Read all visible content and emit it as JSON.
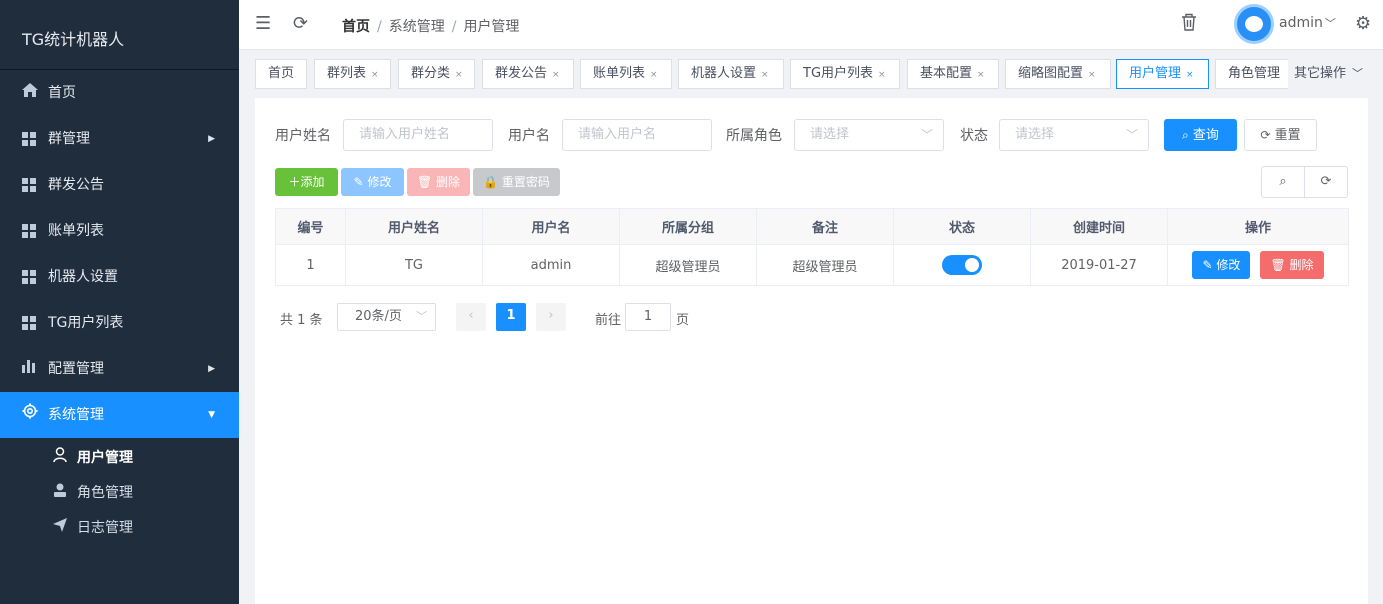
{
  "app": {
    "title": "TG统计机器人"
  },
  "sidebar": {
    "items": [
      {
        "label": "首页",
        "icon": "home-icon"
      },
      {
        "label": "群管理",
        "icon": "grid-icon",
        "expandable": true
      },
      {
        "label": "群发公告",
        "icon": "grid-icon"
      },
      {
        "label": "账单列表",
        "icon": "grid-icon"
      },
      {
        "label": "机器人设置",
        "icon": "grid-icon"
      },
      {
        "label": "TG用户列表",
        "icon": "grid-icon"
      },
      {
        "label": "配置管理",
        "icon": "bar-chart-icon",
        "expandable": true
      },
      {
        "label": "系统管理",
        "icon": "gear-icon",
        "expanded": true
      }
    ],
    "sub_items": [
      {
        "label": "用户管理",
        "icon": "user-icon"
      },
      {
        "label": "角色管理",
        "icon": "role-icon"
      },
      {
        "label": "日志管理",
        "icon": "send-icon"
      }
    ]
  },
  "header": {
    "breadcrumb": [
      "首页",
      "系统管理",
      "用户管理"
    ],
    "username": "admin"
  },
  "tabs": {
    "items": [
      "首页",
      "群列表",
      "群分类",
      "群发公告",
      "账单列表",
      "机器人设置",
      "TG用户列表",
      "基本配置",
      "缩略图配置",
      "用户管理",
      "角色管理"
    ],
    "active": "用户管理",
    "more_label": "其它操作"
  },
  "search": {
    "realname_label": "用户姓名",
    "realname_placeholder": "请输入用户姓名",
    "username_label": "用户名",
    "username_placeholder": "请输入用户名",
    "role_label": "所属角色",
    "role_placeholder": "请选择",
    "status_label": "状态",
    "status_placeholder": "请选择",
    "query_label": "查询",
    "reset_label": "重置"
  },
  "toolbar": {
    "add_label": "添加",
    "edit_label": "修改",
    "delete_label": "删除",
    "reset_pwd_label": "重置密码"
  },
  "table": {
    "columns": [
      "编号",
      "用户姓名",
      "用户名",
      "所属分组",
      "备注",
      "状态",
      "创建时间",
      "操作"
    ],
    "rows": [
      {
        "id": "1",
        "realname": "TG",
        "username": "admin",
        "group": "超级管理员",
        "remark": "超级管理员",
        "status": true,
        "created": "2019-01-27",
        "edit": "修改",
        "delete": "删除"
      }
    ]
  },
  "pagination": {
    "total_text": "共 1 条",
    "page_size": "20条/页",
    "current_page": "1",
    "goto_prefix": "前往",
    "goto_value": "1",
    "goto_suffix": "页"
  },
  "colors": {
    "primary": "#1890ff",
    "success": "#67c23a",
    "danger": "#f56c6c",
    "sidebar": "#1f2d3d"
  }
}
